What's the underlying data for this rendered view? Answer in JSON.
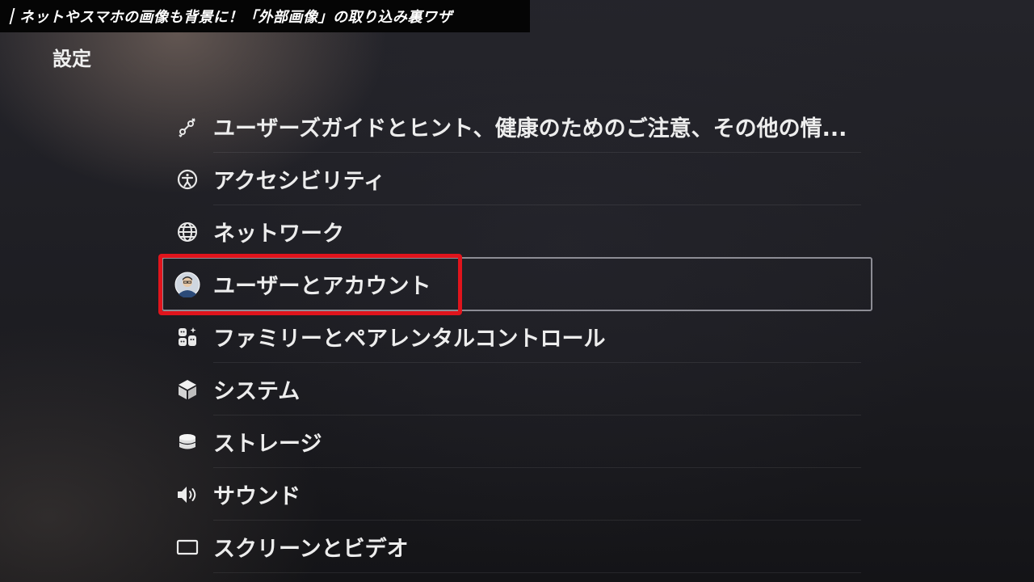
{
  "caption": {
    "text": "ネットやスマホの画像も背景に！「外部画像」の取り込み裏ワザ"
  },
  "page": {
    "title": "設定"
  },
  "menu": {
    "items": [
      {
        "label": "ユーザーズガイドとヒント、健康のためのご注意、その他の情...",
        "icon": "user-guide-icon"
      },
      {
        "label": "アクセシビリティ",
        "icon": "accessibility-icon"
      },
      {
        "label": "ネットワーク",
        "icon": "globe-icon"
      },
      {
        "label": "ユーザーとアカウント",
        "icon": "avatar-icon",
        "focused": true
      },
      {
        "label": "ファミリーとペアレンタルコントロール",
        "icon": "family-icon"
      },
      {
        "label": "システム",
        "icon": "cube-icon"
      },
      {
        "label": "ストレージ",
        "icon": "storage-icon"
      },
      {
        "label": "サウンド",
        "icon": "speaker-icon"
      },
      {
        "label": "スクリーンとビデオ",
        "icon": "screen-icon"
      }
    ]
  },
  "colors": {
    "highlight": "#e0141c",
    "focus_border": "#8d8d95",
    "text": "#ededed",
    "caption_bg": "#050505"
  }
}
